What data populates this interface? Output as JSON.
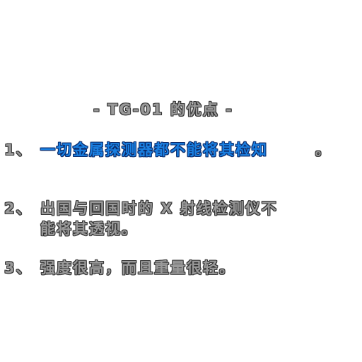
{
  "title": "- TG-01 的优点 -",
  "points": [
    {
      "number": "1、",
      "text": "一切金属探测器都不能将其检知",
      "end": "。",
      "highlight_color": "#1a7fe0"
    },
    {
      "number": "2、",
      "line1": "出国与回国时的 X 射线检测仪不",
      "line2": "能将其透视。"
    },
    {
      "number": "3、",
      "text": "强度很高，而且重量很轻。"
    }
  ]
}
